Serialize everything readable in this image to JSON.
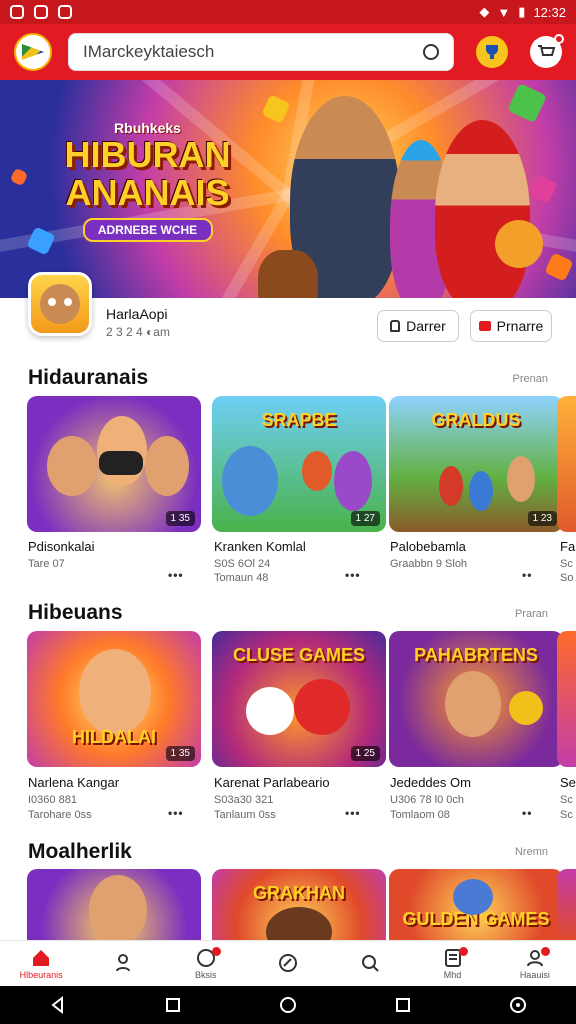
{
  "status_bar": {
    "time": "12:32"
  },
  "search": {
    "text": "IMarckeyktaiesch"
  },
  "banner": {
    "line0": "Rbuhkeks",
    "line1": "HIBURAN",
    "line2": "ANANAIS",
    "ribbon": "ADRNEBE WCHE"
  },
  "app": {
    "name": "HarlaAopi",
    "meta": "2 3 2 4  ◐am",
    "button1_label": "Darrer",
    "button2_label": "Prnarre"
  },
  "sections": [
    {
      "title": "Hidauranais",
      "more": "Prenan",
      "cards": [
        {
          "banner_text": "",
          "badge": "1 35",
          "name": "Pdisonkalai",
          "sub1": "Tare 07",
          "sub2": ""
        },
        {
          "banner_text": "SRAPBE",
          "badge": "1 27",
          "name": "Kranken Komlal",
          "sub1": "S0S 6Ol 24",
          "sub2": "Tomaun 48"
        },
        {
          "banner_text": "GRALDUS",
          "badge": "1 23",
          "name": "Palobebamla",
          "sub1": "Graabbn 9 Sloh",
          "sub2": ""
        },
        {
          "banner_text": "",
          "badge": "",
          "name": "Fa",
          "sub1": "Sc",
          "sub2": "So"
        }
      ]
    },
    {
      "title": "Hibeuans",
      "more": "Praran",
      "cards": [
        {
          "banner_text": "HILDALAI",
          "badge": "1 35",
          "name": "Narlena Kangar",
          "sub1": "I0360 881",
          "sub2": "Tarohare 0ss"
        },
        {
          "banner_text": "CLUSE GAMES",
          "badge": "1 25",
          "name": "Karenat Parlabeario",
          "sub1": "S03a30 321",
          "sub2": "Tanlaum 0ss"
        },
        {
          "banner_text": "PAHABRTENS",
          "badge": "",
          "name": "Jededdes Om",
          "sub1": "U306 78 l0 0ch",
          "sub2": "Tomlaom 08"
        },
        {
          "banner_text": "",
          "badge": "",
          "name": "Se",
          "sub1": "Sc",
          "sub2": "Sc"
        }
      ]
    },
    {
      "title": "Moalherlik",
      "more": "Nremn",
      "cards": [
        {
          "banner_text": "",
          "badge": "",
          "name": "",
          "sub1": "",
          "sub2": ""
        },
        {
          "banner_text": "GRAKHAN",
          "badge": "",
          "name": "",
          "sub1": "",
          "sub2": ""
        },
        {
          "banner_text": "GULDEN GAMES",
          "badge": "",
          "name": "",
          "sub1": "",
          "sub2": ""
        },
        {
          "banner_text": "",
          "badge": "",
          "name": "",
          "sub1": "",
          "sub2": ""
        }
      ]
    }
  ],
  "bottom_nav": [
    {
      "label": "Hlbeuranis",
      "icon": "home-icon"
    },
    {
      "label": "",
      "icon": "person-icon"
    },
    {
      "label": "Bksis",
      "icon": "game-icon"
    },
    {
      "label": "",
      "icon": "category-icon"
    },
    {
      "label": "",
      "icon": "search-icon"
    },
    {
      "label": "Mhd",
      "icon": "list-icon"
    },
    {
      "label": "Haauisi",
      "icon": "profile-icon"
    }
  ],
  "colors": {
    "accent": "#e21a22"
  }
}
